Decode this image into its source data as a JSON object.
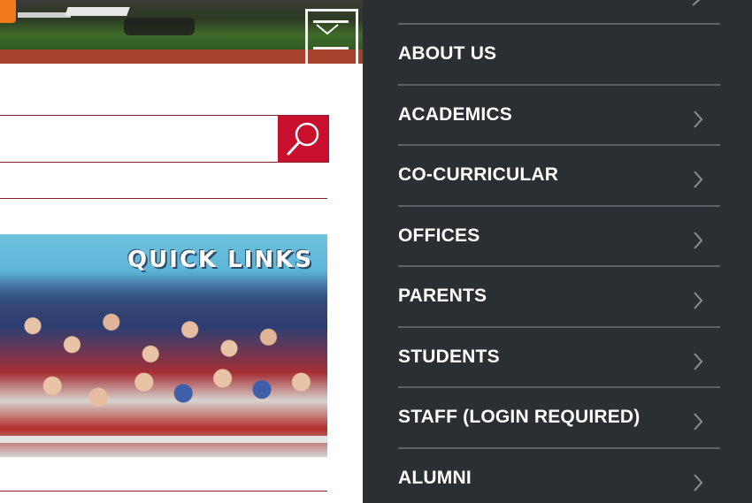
{
  "hero": {
    "icon": "hero-chevron-icon"
  },
  "search": {
    "placeholder": "",
    "value": "",
    "button_icon": "search-icon",
    "accent": "#c8102e"
  },
  "quick_links": {
    "title": "QUICK LINKS"
  },
  "nav": {
    "background": "#2b2e33",
    "items": [
      {
        "label": "ABOUT US",
        "has_arrow": false
      },
      {
        "label": "ACADEMICS",
        "has_arrow": true
      },
      {
        "label": "CO-CURRICULAR",
        "has_arrow": true
      },
      {
        "label": "OFFICES",
        "has_arrow": true
      },
      {
        "label": "PARENTS",
        "has_arrow": true
      },
      {
        "label": "STUDENTS",
        "has_arrow": true
      },
      {
        "label": "STAFF (LOGIN REQUIRED)",
        "has_arrow": true
      },
      {
        "label": "ALUMNI",
        "has_arrow": true
      }
    ]
  }
}
